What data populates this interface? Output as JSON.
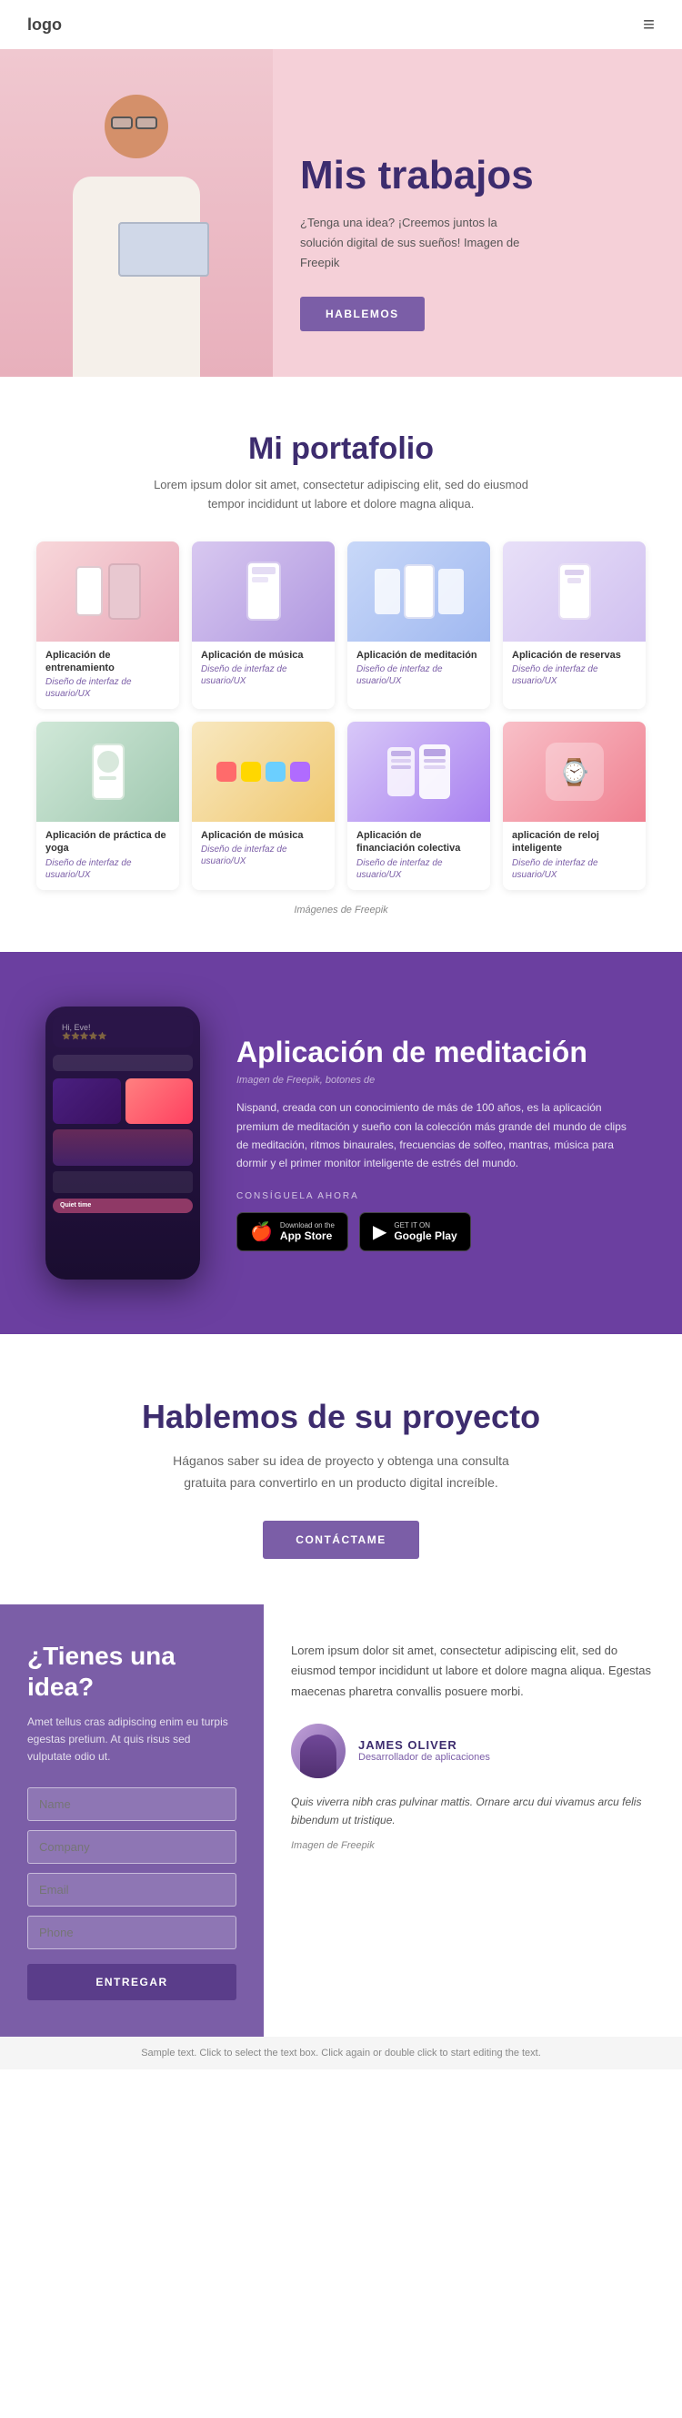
{
  "nav": {
    "logo": "logo",
    "menu_icon": "≡"
  },
  "hero": {
    "title": "Mis trabajos",
    "subtitle": "¿Tenga una idea? ¡Creemos juntos la solución digital de sus sueños! Imagen de Freepik",
    "cta_label": "HABLEMOS"
  },
  "portfolio": {
    "title": "Mi portafolio",
    "description": "Lorem ipsum dolor sit amet, consectetur adipiscing elit, sed do eiusmod tempor incididunt ut labore et dolore magna aliqua.",
    "credit": "Imágenes de Freepik",
    "items": [
      {
        "name": "Aplicación de entrenamiento",
        "type": "Diseño de interfaz de usuario/UX",
        "color": "pink"
      },
      {
        "name": "Aplicación de música",
        "type": "Diseño de interfaz de usuario/UX",
        "color": "purple"
      },
      {
        "name": "Aplicación de meditación",
        "type": "Diseño de interfaz de usuario/UX",
        "color": "blue"
      },
      {
        "name": "Aplicación de reservas",
        "type": "Diseño de interfaz de usuario/UX",
        "color": "lavender"
      },
      {
        "name": "Aplicación de práctica de yoga",
        "type": "Diseño de interfaz de usuario/UX",
        "color": "green"
      },
      {
        "name": "Aplicación de música",
        "type": "Diseño de interfaz de usuario/UX",
        "color": "orange"
      },
      {
        "name": "Aplicación de financiación colectiva",
        "type": "Diseño de interfaz de usuario/UX",
        "color": "violet"
      },
      {
        "name": "aplicación de reloj inteligente",
        "type": "Diseño de interfaz de usuario/UX",
        "color": "coral"
      }
    ]
  },
  "app_section": {
    "title": "Aplicación de meditación",
    "credit": "Imagen de Freepik, botones de",
    "description": "Nispand, creada con un conocimiento de más de 100 años, es la aplicación premium de meditación y sueño con la colección más grande del mundo de clips de meditación, ritmos binaurales, frecuencias de solfeo, mantras, música para dormir y el primer monitor inteligente de estrés del mundo.",
    "consigue_label": "CONSÍGUELA AHORA",
    "app_store_label": "App Store",
    "app_store_sub": "Download on the",
    "google_play_label": "Google Play",
    "google_play_sub": "GET IT ON"
  },
  "contact_section": {
    "title": "Hablemos de su proyecto",
    "description": "Háganos saber su idea de proyecto y obtenga una consulta gratuita para convertirlo en un producto digital increíble.",
    "cta_label": "CONTÁCTAME"
  },
  "bottom": {
    "left": {
      "title": "¿Tienes una idea?",
      "description": "Amet tellus cras adipiscing enim eu turpis egestas pretium. At quis risus sed vulputate odio ut.",
      "name_placeholder": "Name",
      "company_placeholder": "Company",
      "email_placeholder": "Email",
      "phone_placeholder": "Phone",
      "submit_label": "ENTREGAR"
    },
    "right": {
      "description": "Lorem ipsum dolor sit amet, consectetur adipiscing elit, sed do eiusmod tempor incididunt ut labore et dolore magna aliqua. Egestas maecenas pharetra convallis posuere morbi.",
      "profile_name": "JAMES OLIVER",
      "profile_role": "Desarrollador de aplicaciones",
      "quote": "Quis viverra nibh cras pulvinar mattis. Ornare arcu dui vivamus arcu felis bibendum ut tristique.",
      "image_credit": "Imagen de Freepik"
    }
  },
  "footer": {
    "text": "Sample text. Click to select the text box. Click again or double click to start editing the text."
  }
}
